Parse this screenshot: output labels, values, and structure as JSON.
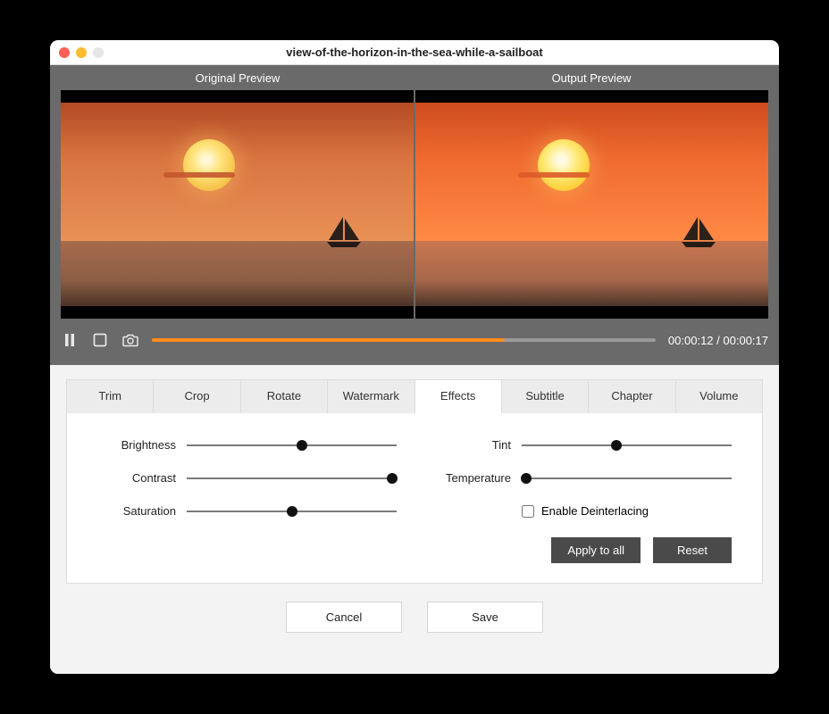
{
  "window": {
    "title": "view-of-the-horizon-in-the-sea-while-a-sailboat"
  },
  "preview": {
    "original_label": "Original Preview",
    "output_label": "Output  Preview"
  },
  "player": {
    "current_time": "00:00:12",
    "total_time": "00:00:17",
    "progress_pct": 70
  },
  "tabs": {
    "trim": "Trim",
    "crop": "Crop",
    "rotate": "Rotate",
    "watermark": "Watermark",
    "effects": "Effects",
    "subtitle": "Subtitle",
    "chapter": "Chapter",
    "volume": "Volume",
    "active": "effects"
  },
  "effects": {
    "brightness": {
      "label": "Brightness",
      "value": 55
    },
    "contrast": {
      "label": "Contrast",
      "value": 98
    },
    "saturation": {
      "label": "Saturation",
      "value": 50
    },
    "tint": {
      "label": "Tint",
      "value": 45
    },
    "temperature": {
      "label": "Temperature",
      "value": 2
    },
    "deinterlace_label": "Enable Deinterlacing",
    "deinterlace_checked": false
  },
  "buttons": {
    "apply_all": "Apply to all",
    "reset": "Reset",
    "cancel": "Cancel",
    "save": "Save"
  }
}
